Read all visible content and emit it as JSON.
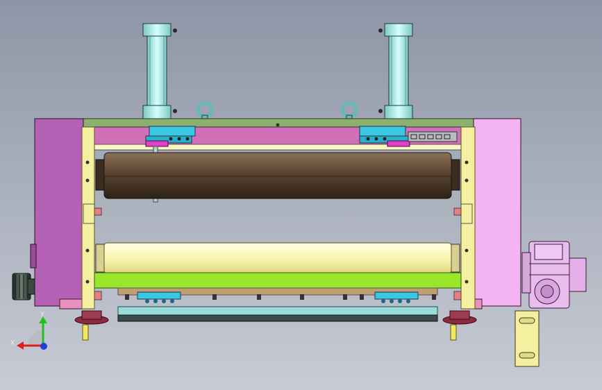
{
  "viewport": {
    "background_top": "#8e95a6",
    "background_bottom": "#c7cbd4"
  },
  "colors": {
    "left_frame": "#b460b4",
    "right_frame": "#f4b4f4",
    "side_plate": "#f4f0a0",
    "upper_roller": "#5a4430",
    "lower_roller": "#fbf7b0",
    "green_bar": "#9ae62a",
    "cylinder": "#a8ece8",
    "blue_block": "#3cc8e4",
    "magenta_pad": "#e040c8",
    "base_plate": "#9adcdc",
    "base_dark": "#3c4a50",
    "gear_motor": "#e8bcec",
    "bracket": "#f4f0a0",
    "eye_bolt": "#a8ece8",
    "foot": "#8c2a40"
  },
  "triad": {
    "x_label": "X",
    "y_label": "Y",
    "x_color": "#e02020",
    "y_color": "#20c020",
    "z_color": "#2040e0"
  }
}
